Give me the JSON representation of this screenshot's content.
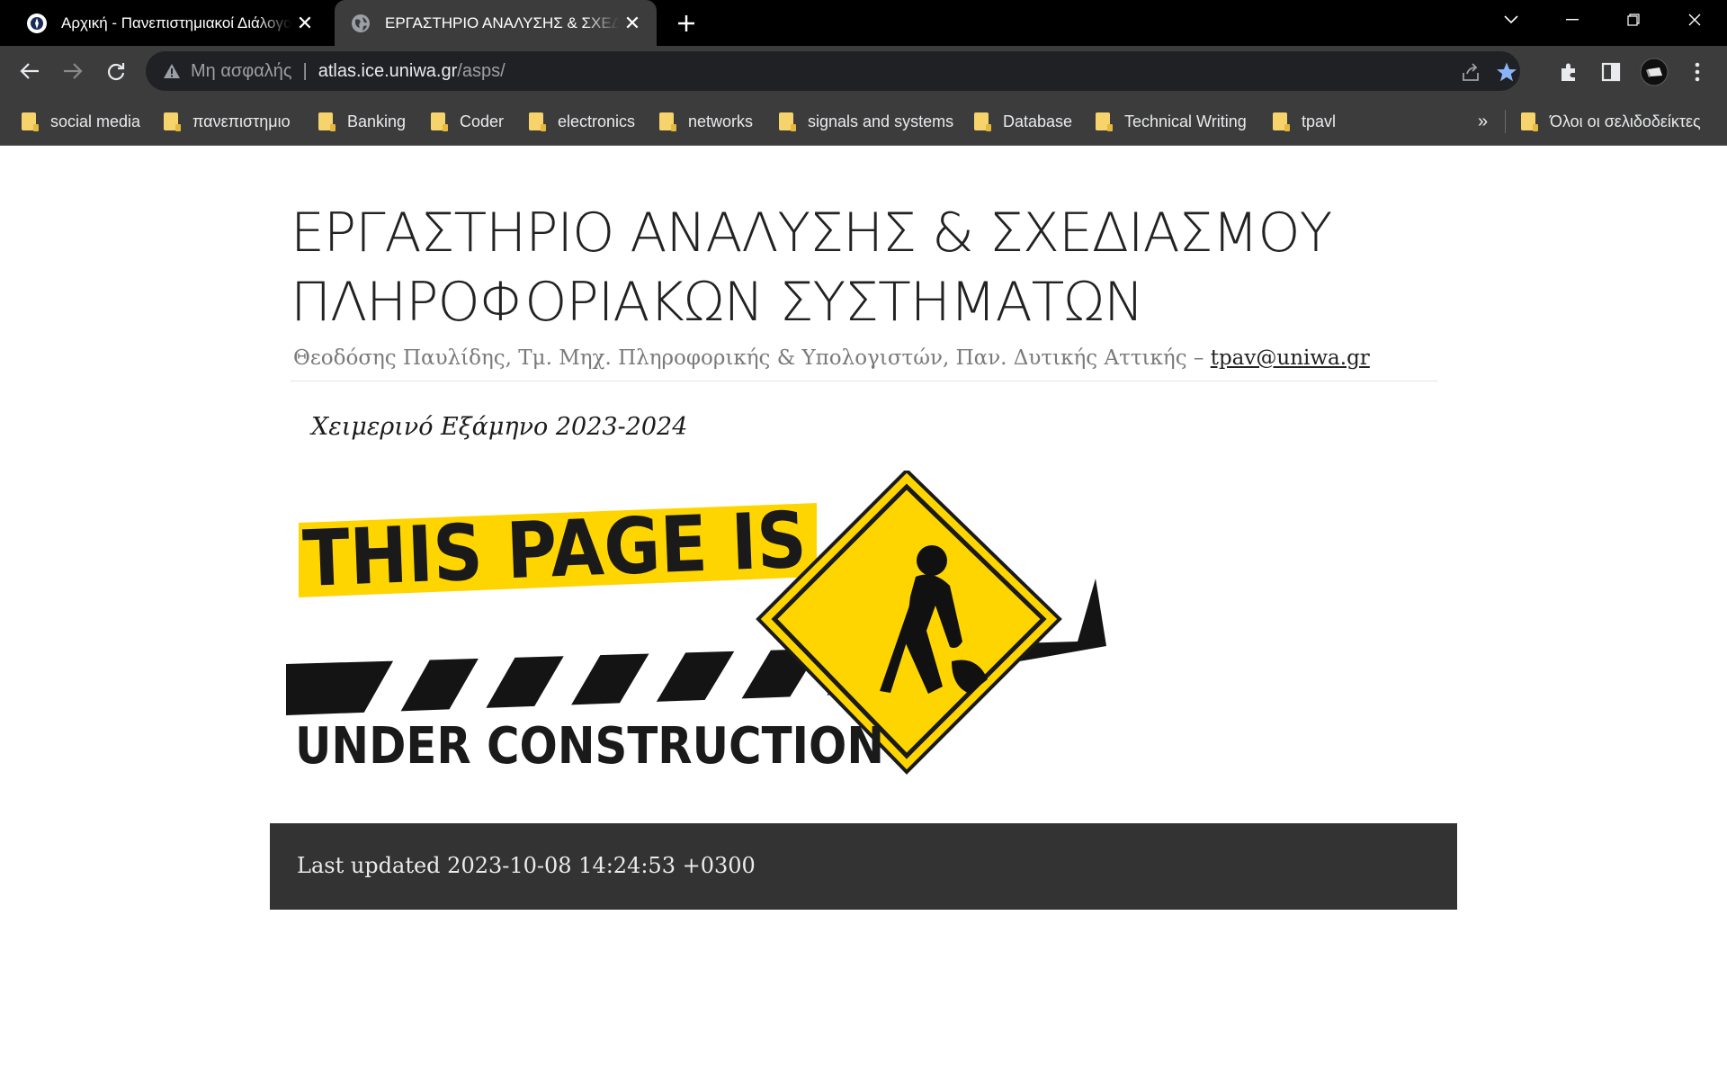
{
  "browser": {
    "tabs": [
      {
        "title": "Αρχική - Πανεπιστημιακοί Διάλογοι",
        "favicon": "uniwa-favicon",
        "active": false
      },
      {
        "title": "ΕΡΓΑΣΤΗΡΙΟ ΑΝΑΛΥΣΗΣ & ΣΧΕΔΙΑΣΜΟΥ",
        "favicon": "globe-icon",
        "active": true
      }
    ],
    "address_bar": {
      "security_label": "Μη ασφαλής",
      "separator": "|",
      "host": "atlas.ice.uniwa.gr",
      "path": "/asps/"
    },
    "bookmarks": [
      "social media",
      "πανεπιστημιο",
      "Banking",
      "Coder",
      "electronics",
      "networks",
      "signals and systems",
      "Database",
      "Technical Writing",
      "tpavl"
    ],
    "bookmarks_overflow": "»",
    "all_bookmarks_label": "Όλοι οι σελιδοδείκτες"
  },
  "page": {
    "title_line1": "ΕΡΓΑΣΤΗΡΙΟ ΑΝΑΛΥΣΗΣ & ΣΧΕΔΙΑΣΜΟΥ",
    "title_line2": "ΠΛΗΡΟΦΟΡΙΑΚΩΝ ΣΥΣΤΗΜΑΤΩΝ",
    "subtitle": "Θεοδόσης Παυλίδης, Τμ. Μηχ. Πληροφορικής & Υπολογιστών, Παν. Δυτικής Αττικής – ",
    "email": "tpav@uniwa.gr",
    "semester": "Χειμερινό Εξάμηνο 2023-2024",
    "banner": {
      "line1": "THIS PAGE IS",
      "line2": "UNDER CONSTRUCTION"
    },
    "footer": "Last updated 2023-10-08 14:24:53 +0300"
  },
  "colors": {
    "tab_strip": "#000000",
    "toolbar": "#3c3c3c",
    "omnibox": "#202124",
    "star": "#8ab4f8",
    "folder": "#f6d36b",
    "footer_bg": "#333333",
    "sign_yellow": "#ffd500"
  }
}
